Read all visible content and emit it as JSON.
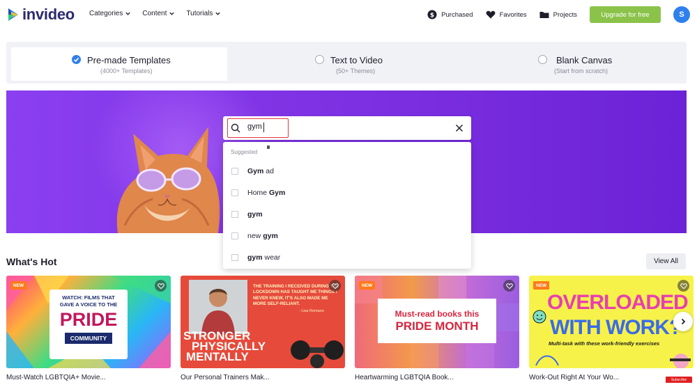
{
  "brand": {
    "name": "invideo"
  },
  "nav": {
    "menu": [
      {
        "label": "Categories"
      },
      {
        "label": "Content"
      },
      {
        "label": "Tutorials"
      }
    ],
    "purchased": "Purchased",
    "favorites": "Favorites",
    "projects": "Projects",
    "upgrade": "Upgrade for free",
    "avatar_initial": "S"
  },
  "modes": [
    {
      "title": "Pre-made Templates",
      "subtitle": "(4000+ Templates)",
      "selected": true
    },
    {
      "title": "Text to Video",
      "subtitle": "(50+ Themes)",
      "selected": false
    },
    {
      "title": "Blank Canvas",
      "subtitle": "(Start from scratch)",
      "selected": false
    }
  ],
  "search": {
    "value": "gym",
    "suggested_label": "Suggested",
    "suggestions": [
      {
        "bold": "Gym",
        "rest": " ad",
        "bold_first": true
      },
      {
        "rest": "Home ",
        "bold": "Gym",
        "bold_first": false
      },
      {
        "bold": "gym",
        "rest": "",
        "bold_first": true
      },
      {
        "rest": "new ",
        "bold": "gym",
        "bold_first": false
      },
      {
        "bold": "gym",
        "rest": " wear",
        "bold_first": true
      }
    ]
  },
  "section": {
    "title": "What's Hot",
    "view_all": "View All"
  },
  "cards": [
    {
      "title": "Must-Watch LGBTQIA+ Movie...",
      "badge": "NEW",
      "line1": "WATCH: FILMS THAT",
      "line2": "GAVE A VOICE TO THE",
      "big": "PRIDE",
      "small": "COMMUNITY"
    },
    {
      "title": "Our Personal Trainers Mak...",
      "quote": "THE TRAINING I RECEIVED DURING THE LOCKDOWN HAS TAUGHT ME THINGS I NEVER KNEW, IT'S ALSO MADE ME MORE SELF-RELIANT.",
      "quote_author": "- Lisa Romano",
      "big1": "STRONGER",
      "big2": "PHYSICALLY",
      "big3": "MENTALLY"
    },
    {
      "title": "Heartwarming LGBTQIA Book...",
      "badge": "NEW",
      "line1": "Must-read books this",
      "big": "PRIDE MONTH"
    },
    {
      "title": "Work-Out Right At Your Wo...",
      "badge": "NEW",
      "big1": "OVERLOADED",
      "big2": "WITH WORK?",
      "small": "Multi-task with these work-friendly exercises"
    }
  ],
  "colors": {
    "accent_blue": "#2f80ed",
    "upgrade_green": "#8bc34a",
    "hero_purple": "#7b2fe0",
    "badge_orange": "#ff7a1a",
    "search_highlight": "#e0393e"
  },
  "subscribe_label": "Subscribe"
}
